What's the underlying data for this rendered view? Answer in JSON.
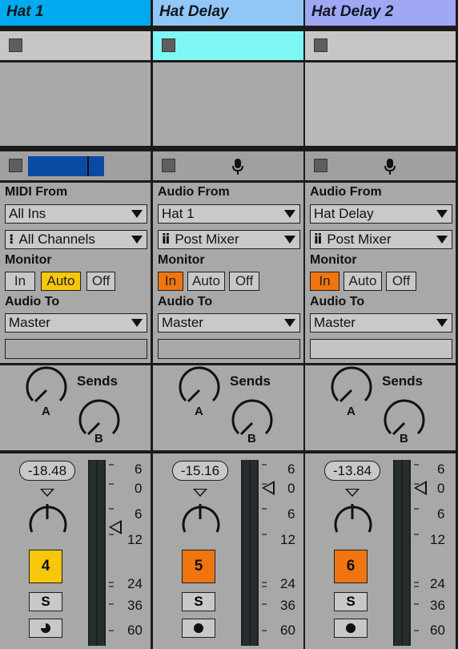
{
  "tracks": [
    {
      "name": "Hat 1",
      "header_color": "#00aaee",
      "clip_active": false,
      "input_label": "MIDI From",
      "input_source": "All Ins",
      "input_channel": "All Channels",
      "channel_icon": "⁝",
      "monitor_label": "Monitor",
      "monitor": {
        "in": "In",
        "auto": "Auto",
        "off": "Off",
        "selected": "auto"
      },
      "output_label": "Audio To",
      "output": "Master",
      "sends_label": "Sends",
      "knob_a": "A",
      "knob_b": "B",
      "volume": "-18.48",
      "track_number": "4",
      "track_number_color": "#f6c70a",
      "solo": "S",
      "arm_icon": "half-dot-icon",
      "meter_ticks": [
        "6",
        "0",
        "6",
        "12",
        "24",
        "36",
        "60"
      ],
      "level_marker_db": "12"
    },
    {
      "name": "Hat Delay",
      "header_color": "#91c6f7",
      "clip_active": true,
      "input_label": "Audio From",
      "input_source": "Hat 1",
      "input_channel": "Post Mixer",
      "channel_icon": "ⅱ",
      "monitor_label": "Monitor",
      "monitor": {
        "in": "In",
        "auto": "Auto",
        "off": "Off",
        "selected": "in"
      },
      "output_label": "Audio To",
      "output": "Master",
      "sends_label": "Sends",
      "knob_a": "A",
      "knob_b": "B",
      "volume": "-15.16",
      "track_number": "5",
      "track_number_color": "#f07410",
      "solo": "S",
      "arm_icon": "dot-icon",
      "meter_ticks": [
        "6",
        "0",
        "6",
        "12",
        "24",
        "36",
        "60"
      ],
      "level_marker_db": "0"
    },
    {
      "name": "Hat Delay 2",
      "header_color": "#a0a8f6",
      "clip_active": false,
      "input_label": "Audio From",
      "input_source": "Hat Delay",
      "input_channel": "Post Mixer",
      "channel_icon": "ⅱ",
      "monitor_label": "Monitor",
      "monitor": {
        "in": "In",
        "auto": "Auto",
        "off": "Off",
        "selected": "in"
      },
      "output_label": "Audio To",
      "output": "Master",
      "sends_label": "Sends",
      "knob_a": "A",
      "knob_b": "B",
      "volume": "-13.84",
      "track_number": "6",
      "track_number_color": "#f07410",
      "solo": "S",
      "arm_icon": "dot-icon",
      "meter_ticks": [
        "6",
        "0",
        "6",
        "12",
        "24",
        "36",
        "60"
      ],
      "level_marker_db": "0"
    }
  ]
}
